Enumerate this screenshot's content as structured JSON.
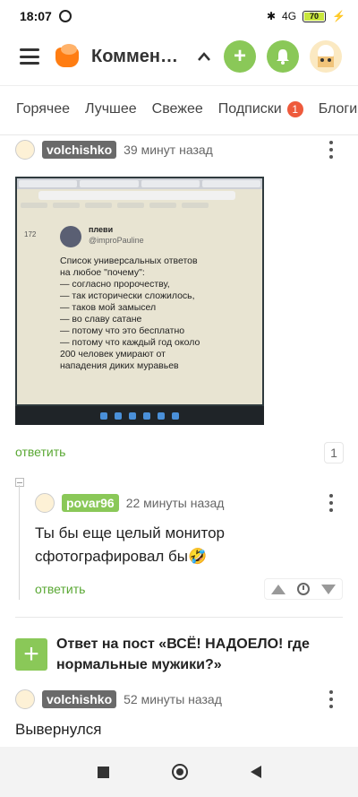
{
  "status_bar": {
    "time": "18:07",
    "network": "4G",
    "battery": "70"
  },
  "app_bar": {
    "title": "Комментарии"
  },
  "tabs": [
    {
      "label": "Горячее"
    },
    {
      "label": "Лучшее"
    },
    {
      "label": "Свежее"
    },
    {
      "label": "Подписки",
      "badge": "1"
    },
    {
      "label": "Блоги"
    }
  ],
  "comments": [
    {
      "author": "volchishko",
      "time": "39 минут назад",
      "reply_label": "ответить",
      "replies_count": "1",
      "photo": {
        "tweet_author": "плеви",
        "tweet_handle": "@improPauline",
        "tweet_text": "Список универсальных ответов\nна любое \"почему\":\n— согласно пророчеству,\n— так исторически сложилось,\n— таков мой замысел\n— во славу сатане\n— потому что это бесплатно\n— потому что каждый год около\n200 человек умирают от\nнападения диких муравьев",
        "sidebar_count": "172"
      }
    },
    {
      "author": "povar96",
      "time": "22 минуты назад",
      "text": "Ты бы еще целый монитор сфотографировал бы🤣",
      "reply_label": "ответить"
    }
  ],
  "post_answer": {
    "title": "Ответ на пост «ВСЁ! НАДОЕЛО! где нормальные мужики?»"
  },
  "last_comment": {
    "author": "volchishko",
    "time": "52 минуты назад",
    "text": "Вывернулся"
  },
  "colors": {
    "accent_green": "#8ac858",
    "link_green": "#5aa834",
    "badge_red": "#ee5a3c",
    "nick_gray": "#6a6a6a"
  }
}
